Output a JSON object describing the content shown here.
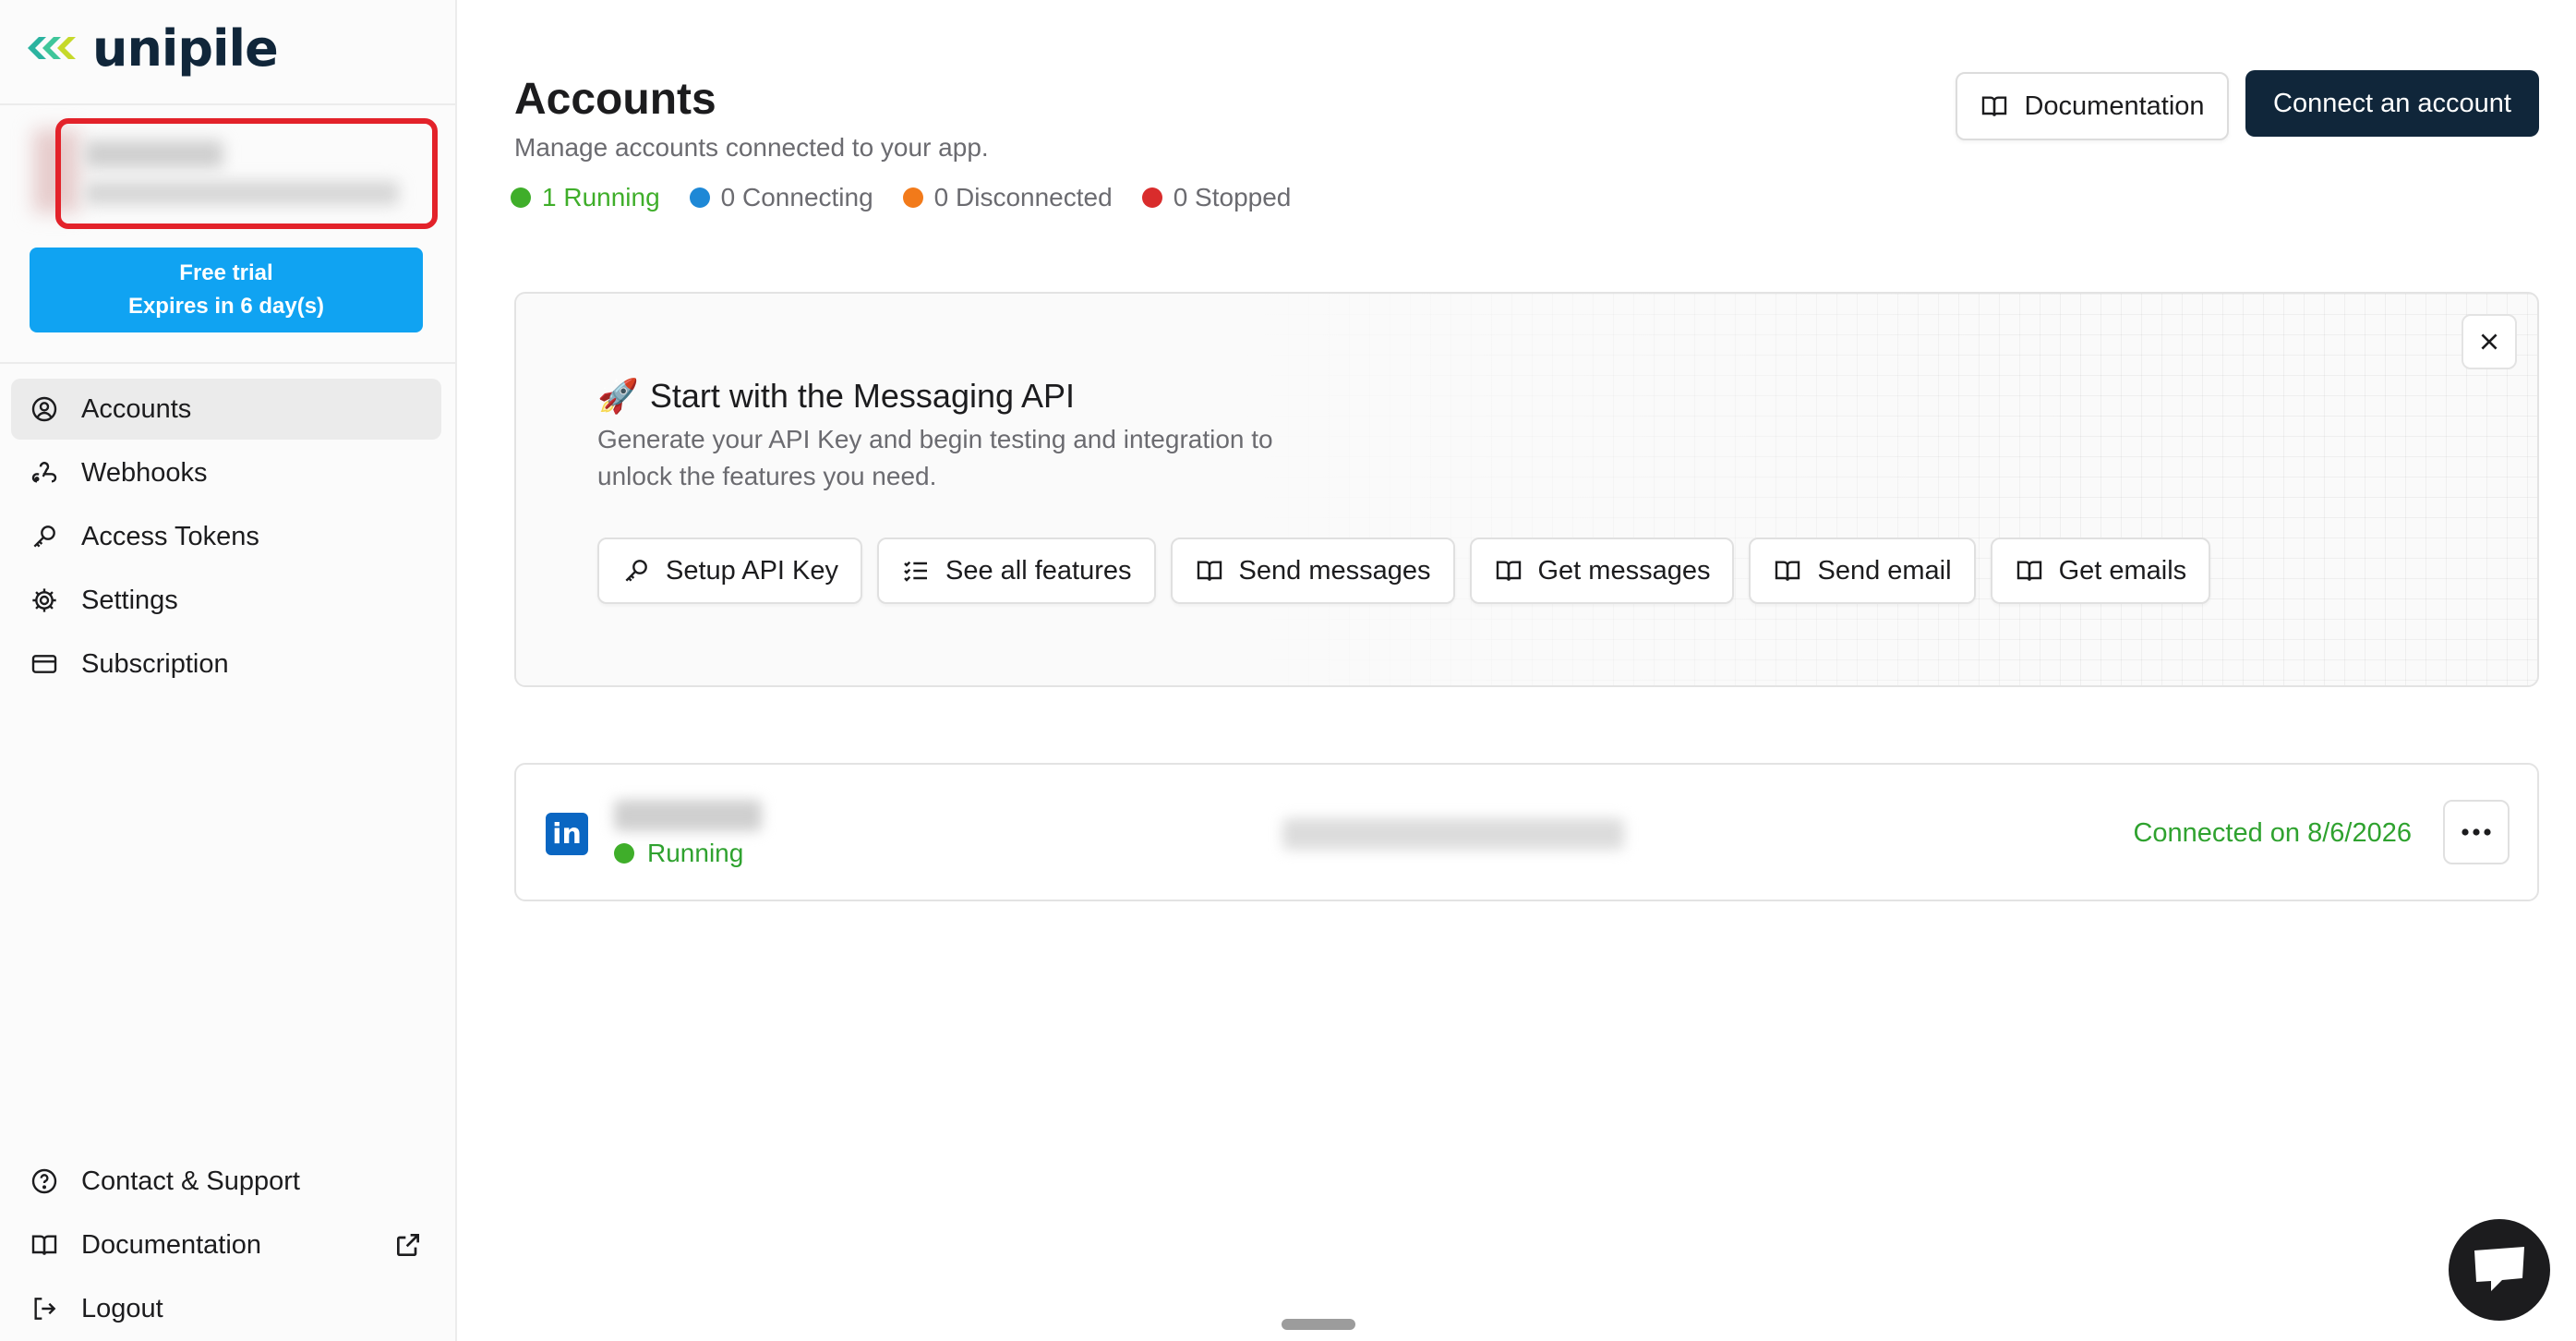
{
  "brand": {
    "name": "unipile"
  },
  "trial": {
    "line1": "Free trial",
    "line2": "Expires in 6 day(s)"
  },
  "sidebar": {
    "items": [
      {
        "label": "Accounts",
        "icon": "user-circle-icon"
      },
      {
        "label": "Webhooks",
        "icon": "webhook-icon"
      },
      {
        "label": "Access Tokens",
        "icon": "key-icon"
      },
      {
        "label": "Settings",
        "icon": "gear-icon"
      },
      {
        "label": "Subscription",
        "icon": "credit-card-icon"
      }
    ],
    "bottom": [
      {
        "label": "Contact & Support",
        "icon": "help-circle-icon"
      },
      {
        "label": "Documentation",
        "icon": "book-icon"
      },
      {
        "label": "Logout",
        "icon": "logout-icon"
      }
    ]
  },
  "header": {
    "title": "Accounts",
    "subtitle": "Manage accounts connected to your app.",
    "doc_button": "Documentation",
    "connect_button": "Connect an account"
  },
  "statuses": [
    {
      "label": "1 Running",
      "color": "#3fae2a"
    },
    {
      "label": "0 Connecting",
      "color": "#1e88d6"
    },
    {
      "label": "0 Disconnected",
      "color": "#f27a1a"
    },
    {
      "label": "0 Stopped",
      "color": "#d92c2c"
    }
  ],
  "promo": {
    "emoji": "🚀",
    "title": "Start with the Messaging API",
    "description": "Generate your API Key and begin testing and integration to unlock the features you need.",
    "actions": [
      {
        "label": "Setup API Key",
        "icon": "key-icon"
      },
      {
        "label": "See all features",
        "icon": "checklist-icon"
      },
      {
        "label": "Send messages",
        "icon": "book-icon"
      },
      {
        "label": "Get messages",
        "icon": "book-icon"
      },
      {
        "label": "Send email",
        "icon": "book-icon"
      },
      {
        "label": "Get emails",
        "icon": "book-icon"
      }
    ]
  },
  "account": {
    "provider_logo": "in",
    "status": "Running",
    "connected": "Connected on 8/6/2026"
  },
  "colors": {
    "accent_dark": "#10263a",
    "trial_blue": "#10a3f2",
    "success_green": "#2fa22f",
    "linkedin_blue": "#0a66c2"
  }
}
